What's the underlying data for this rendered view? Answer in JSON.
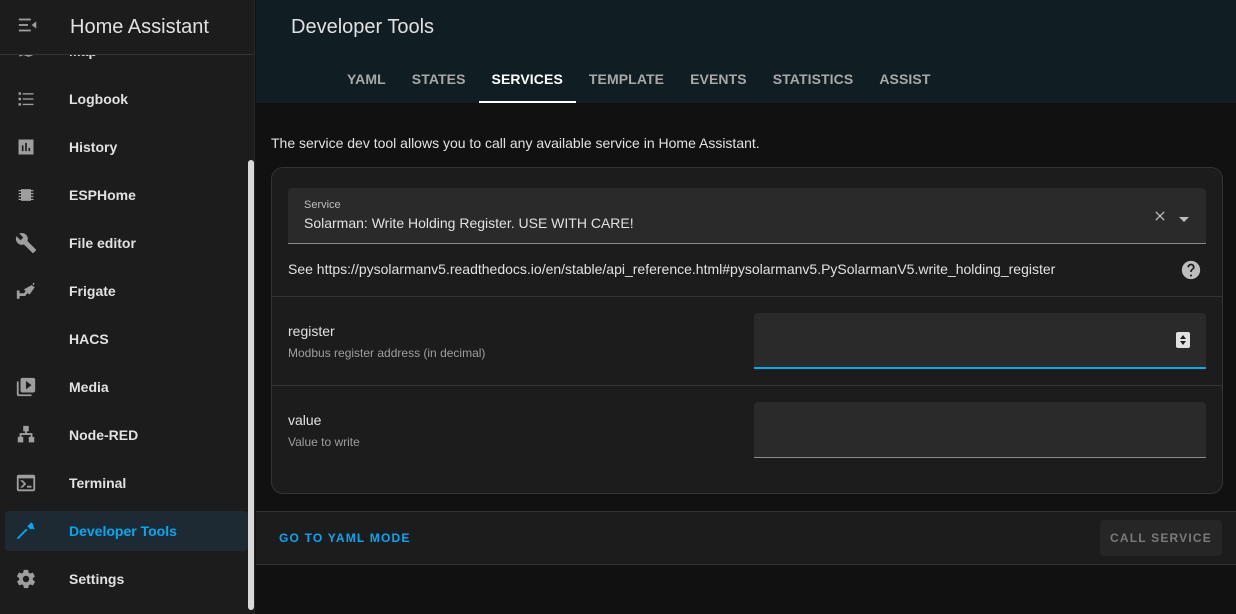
{
  "app": {
    "title": "Home Assistant"
  },
  "sidebar": {
    "items": [
      {
        "label": "Map",
        "icon": "map-icon"
      },
      {
        "label": "Logbook",
        "icon": "logbook-icon"
      },
      {
        "label": "History",
        "icon": "history-icon"
      },
      {
        "label": "ESPHome",
        "icon": "chip-icon"
      },
      {
        "label": "File editor",
        "icon": "wrench-icon"
      },
      {
        "label": "Frigate",
        "icon": "cctv-icon"
      },
      {
        "label": "HACS",
        "icon": ""
      },
      {
        "label": "Media",
        "icon": "media-icon"
      },
      {
        "label": "Node-RED",
        "icon": "sitemap-icon"
      },
      {
        "label": "Terminal",
        "icon": "console-icon"
      },
      {
        "label": "Developer Tools",
        "icon": "hammer-icon",
        "active": true
      },
      {
        "label": "Settings",
        "icon": "gear-icon"
      }
    ]
  },
  "header": {
    "title": "Developer Tools",
    "tabs": [
      {
        "label": "YAML"
      },
      {
        "label": "STATES"
      },
      {
        "label": "SERVICES",
        "active": true
      },
      {
        "label": "TEMPLATE"
      },
      {
        "label": "EVENTS"
      },
      {
        "label": "STATISTICS"
      },
      {
        "label": "ASSIST"
      }
    ]
  },
  "main": {
    "intro": "The service dev tool allows you to call any available service in Home Assistant.",
    "service": {
      "label": "Service",
      "value": "Solarman: Write Holding Register. USE WITH CARE!",
      "description": "See https://pysolarmanv5.readthedocs.io/en/stable/api_reference.html#pysolarmanv5.PySolarmanV5.write_holding_register"
    },
    "params": [
      {
        "name": "register",
        "description": "Modbus register address (in decimal)",
        "value": ""
      },
      {
        "name": "value",
        "description": "Value to write",
        "value": ""
      }
    ],
    "footer": {
      "yaml_mode_label": "GO TO YAML MODE",
      "call_service_label": "CALL SERVICE"
    }
  },
  "colors": {
    "accent": "#03a9f4",
    "sidebar_bg": "#1c1c1c",
    "header_bg": "#101e24",
    "page_bg": "#111111"
  }
}
